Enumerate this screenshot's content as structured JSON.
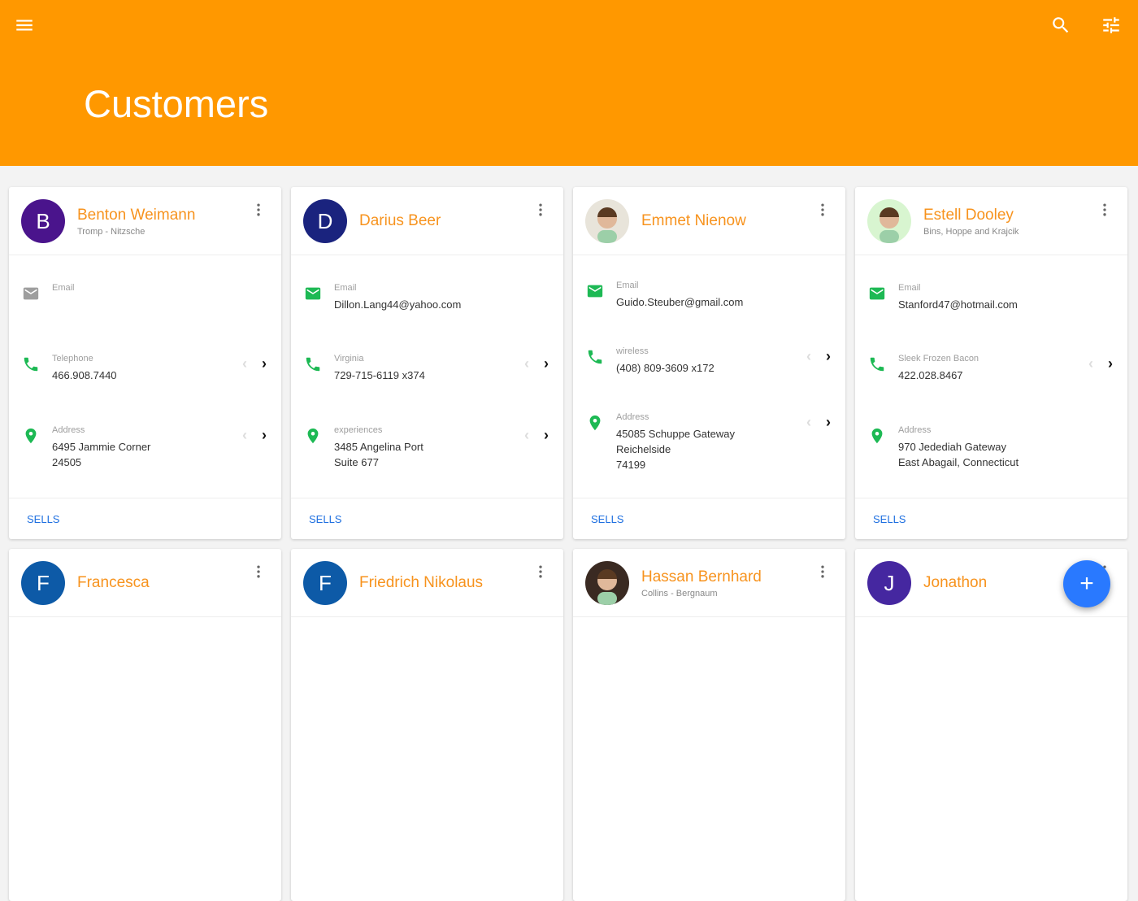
{
  "header": {
    "title": "Customers",
    "menu_icon": "menu-icon",
    "search_icon": "search-icon",
    "filter_icon": "tune-icon"
  },
  "colors": {
    "appbar": "#FF9800",
    "name": "#F7931E",
    "icon_green": "#1DB954",
    "link": "#1E6FE0",
    "fab": "#2979FF"
  },
  "fab": {
    "label": "+"
  },
  "customers": [
    {
      "initial": "B",
      "avatar_color": "#4A148C",
      "name": "Benton Weimann",
      "company": "Tromp - Nitzsche",
      "email_label": "Email",
      "email": "",
      "email_active": false,
      "phone_label": "Telephone",
      "phone": "466.908.7440",
      "address_label": "Address",
      "address": [
        "6495 Jammie Corner",
        "24505"
      ],
      "address_nav": true,
      "action": "SELLS"
    },
    {
      "initial": "D",
      "avatar_color": "#1A237E",
      "name": "Darius Beer",
      "company": "",
      "email_label": "Email",
      "email": "Dillon.Lang44@yahoo.com",
      "email_active": true,
      "phone_label": "Virginia",
      "phone": "729-715-6119 x374",
      "address_label": "experiences",
      "address": [
        "3485 Angelina Port",
        "Suite 677"
      ],
      "address_nav": true,
      "action": "SELLS"
    },
    {
      "initial": "",
      "avatar_color": "#E8E4DA",
      "photo": "illustrated avatar",
      "name": "Emmet Nienow",
      "company": "",
      "email_label": "Email",
      "email": "Guido.Steuber@gmail.com",
      "email_active": true,
      "phone_label": "wireless",
      "phone": "(408) 809-3609 x172",
      "address_label": "Address",
      "address": [
        "45085 Schuppe Gateway",
        "Reichelside",
        "74199"
      ],
      "address_nav": true,
      "action": "SELLS"
    },
    {
      "initial": "",
      "avatar_color": "#D8F5D0",
      "photo": "illustrated avatar",
      "name": "Estell Dooley",
      "company": "Bins, Hoppe and Krajcik",
      "email_label": "Email",
      "email": "Stanford47@hotmail.com",
      "email_active": true,
      "phone_label": "Sleek Frozen Bacon",
      "phone": "422.028.8467",
      "address_label": "Address",
      "address": [
        "970 Jedediah Gateway",
        "East Abagail, Connecticut"
      ],
      "address_nav": false,
      "action": "SELLS"
    },
    {
      "initial": "F",
      "avatar_color": "#0D5AA7",
      "name": "Francesca",
      "company": ""
    },
    {
      "initial": "F",
      "avatar_color": "#0D5AA7",
      "name": "Friedrich Nikolaus",
      "company": ""
    },
    {
      "initial": "",
      "avatar_color": "#3a2a22",
      "photo": "photo avatar",
      "name": "Hassan Bernhard",
      "company": "Collins - Bergnaum"
    },
    {
      "initial": "J",
      "avatar_color": "#4527A0",
      "name": "Jonathon",
      "company": ""
    }
  ]
}
